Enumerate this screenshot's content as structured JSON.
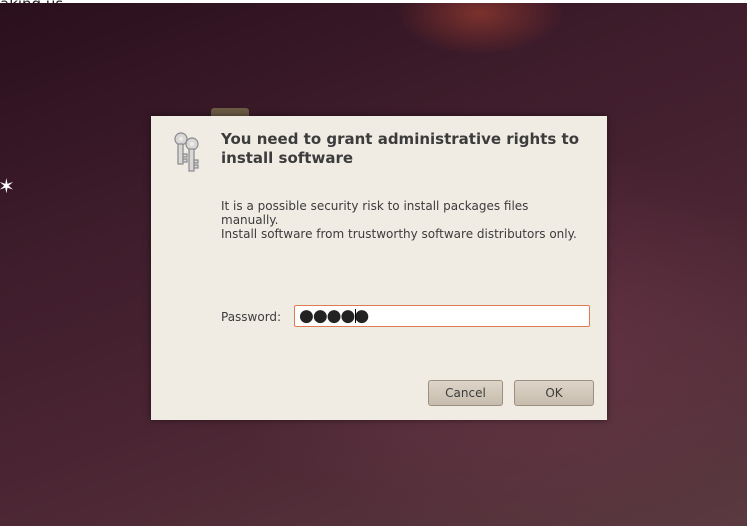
{
  "top_strip": {
    "text": "aking us"
  },
  "dialog": {
    "title": "You need to grant administrative rights to install software",
    "message_lines": [
      "It is a possible security risk to install packages files",
      "manually.",
      "Install software from trustworthy software distributors only."
    ],
    "password_label": "Password:",
    "password_value": "●●●●●",
    "cancel_label": "Cancel",
    "ok_label": "OK",
    "icon": "keys-icon"
  },
  "colors": {
    "dialog_bg": "#f0ebe3",
    "field_focus_border": "#e07a55",
    "desktop_dark": "#2a0f1c"
  }
}
